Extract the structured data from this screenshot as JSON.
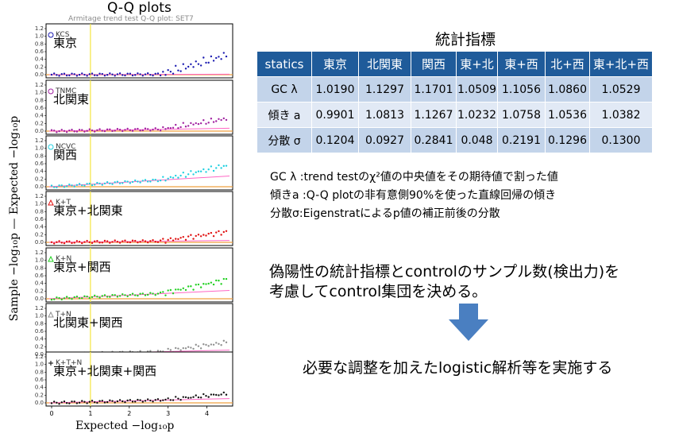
{
  "figure": {
    "title": "Q-Q plots",
    "faint_title": "Armitage trend test Q-Q plot: SET7",
    "xlabel": "Expected  −log₁₀p",
    "ylabel": "Sample −log₁₀p  — Expected −log₁₀p"
  },
  "chart_data": {
    "type": "scatter",
    "x_ticks": [
      "0",
      "1",
      "2",
      "3",
      "4"
    ],
    "xlim": [
      0,
      4.5
    ],
    "y_ticks": [
      "0.0",
      "0.2",
      "0.4",
      "0.6",
      "0.8",
      "1.0",
      "1.2"
    ],
    "ylim": [
      0,
      1.2
    ],
    "vline_x": 1,
    "panels": [
      {
        "label": "東京",
        "tag": "KCS",
        "marker": "circle",
        "color": "#1a1ab0"
      },
      {
        "label": "北関東",
        "tag": "TNMC",
        "marker": "circle",
        "color": "#a020a0"
      },
      {
        "label": "関西",
        "tag": "NCVC",
        "marker": "circle",
        "color": "#20d0e0"
      },
      {
        "label": "東京+北関東",
        "tag": "K+T",
        "marker": "triangle",
        "color": "#e01010"
      },
      {
        "label": "東京+関西",
        "tag": "K+N",
        "marker": "triangle",
        "color": "#20d020"
      },
      {
        "label": "北関東+関西",
        "tag": "T+N",
        "marker": "triangle",
        "color": "#909090"
      },
      {
        "label": "東京+北関東+関西",
        "tag": "K+T+N",
        "marker": "plus",
        "color": "#101010"
      }
    ]
  },
  "stats": {
    "title": "統計指標",
    "headers": [
      "statics",
      "東京",
      "北関東",
      "関西",
      "東+北",
      "東+西",
      "北+西",
      "東+北+西"
    ],
    "rows": [
      {
        "label": "GC λ",
        "values": [
          "1.0190",
          "1.1297",
          "1.1701",
          "1.0509",
          "1.1056",
          "1.0860",
          "1.0529"
        ]
      },
      {
        "label": "傾き a",
        "values": [
          "0.9901",
          "1.0813",
          "1.1267",
          "1.0232",
          "1.0758",
          "1.0536",
          "1.0382"
        ]
      },
      {
        "label": "分散 σ",
        "values": [
          "0.1204",
          "0.0927",
          "0.2841",
          "0.048",
          "0.2191",
          "0.1296",
          "0.1300"
        ]
      }
    ]
  },
  "notes": [
    "GC λ  :trend testのχ²値の中央値をその期待値で割った値",
    "傾きa :Q-Q plotの非有意側90%を使った直線回帰の傾き",
    "分散σ:Eigenstratによるp値の補正前後の分散"
  ],
  "paragraph": [
    "偽陽性の統計指標とcontrolのサンプル数(検出力)を",
    "考慮してcontrol集団を決める。"
  ],
  "conclusion": "必要な調整を加えたlogistic解析等を実施する",
  "colors": {
    "arrow": "#4a7fc1",
    "header": "#1f5b9a",
    "band": "#c3d4ea",
    "band_light": "#e1e9f5"
  }
}
